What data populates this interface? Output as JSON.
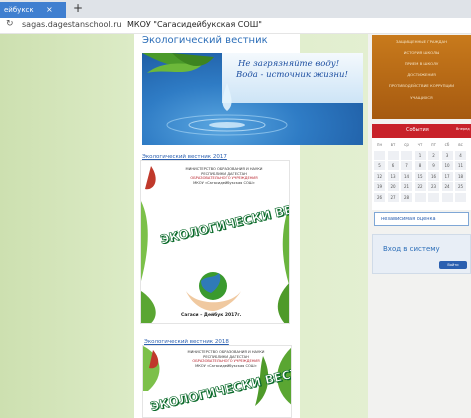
{
  "browser": {
    "tab_title": "ейбукск",
    "tab_close": "×",
    "new_tab": "+",
    "reload_icon": "↻",
    "url": "sagas.dagestanschool.ru",
    "page_title": "МКОУ \"Сагасидейбукская СОШ\""
  },
  "site": {
    "title": "Экологический вестник",
    "banner_line1": "Не загрязняйте воду!",
    "banner_line2": "Вода - источник жизни!"
  },
  "articles": [
    {
      "link": "Экологический вестник 2017",
      "header": [
        "МИНИСТЕРСТВО ОБРАЗОВАНИЯ И НАУКИ",
        "РЕСПУБЛИКИ ДАГЕСТАН",
        "ОБРАЗОВАТЕЛЬНОГО УЧРЕЖДЕНИЯ",
        "МКОУ «Сагасидейбукская СОШ»"
      ],
      "title": "ЭКОЛОГИЧЕСКИ ВЕСТНИК",
      "footer": "Сагаси – Дейбук 2017г."
    },
    {
      "link": "Экологический вестник 2018",
      "header": [
        "МИНИСТЕРСТВО ОБРАЗОВАНИЯ И НАУКИ",
        "РЕСПУБЛИКИ ДАГЕСТАН",
        "ОБРАЗОВАТЕЛЬНОГО УЧРЕЖДЕНИЯ",
        "МКОУ «Сагасидейбукская СОШ»"
      ],
      "title": "ЭКОЛОГИЧЕСКИ ВЕСТНИК"
    }
  ],
  "sidebar": {
    "menu": [
      "ЗАЩИЩЕННЫЕ ГРАЖДАН",
      "ИСТОРИЯ ШКОЛЫ",
      "ПРИЕМ В ШКОЛУ",
      "ДОСТИЖЕНИЯ",
      "ПРОТИВОДЕЙСТВИЕ КОРРУПЦИИ",
      "УЧАЩИХСЯ"
    ],
    "calendar_title": "События",
    "calendar_more": "Вперед",
    "weekdays": [
      "пн",
      "вт",
      "ср",
      "чт",
      "пт",
      "сб",
      "вс"
    ],
    "days": [
      "",
      "",
      "",
      "1",
      "2",
      "3",
      "4",
      "5",
      "6",
      "7",
      "8",
      "9",
      "10",
      "11",
      "12",
      "13",
      "14",
      "15",
      "16",
      "17",
      "18",
      "19",
      "20",
      "21",
      "22",
      "23",
      "24",
      "25",
      "26",
      "27",
      "28",
      "",
      "",
      "",
      ""
    ],
    "independent_rating": "независимая оценка",
    "login_title": "Вход в систему",
    "login_button": "Войти"
  }
}
